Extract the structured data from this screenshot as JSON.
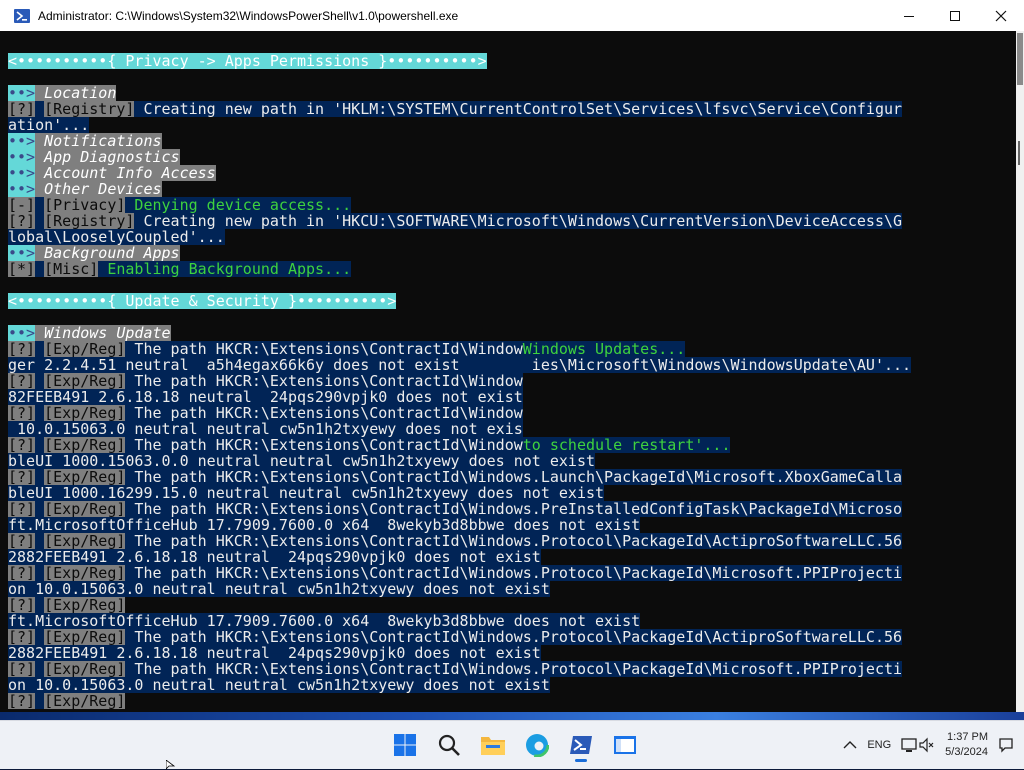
{
  "window": {
    "title": "Administrator: C:\\Windows\\System32\\WindowsPowerShell\\v1.0\\powershell.exe"
  },
  "console": {
    "lines": [
      [],
      [
        {
          "t": "<••••••••••{ ",
          "c": "hdr"
        },
        {
          "t": "Privacy -> Apps Permissions",
          "c": "hdr t"
        },
        {
          "t": " }••••••••••>",
          "c": "hdr"
        }
      ],
      [],
      [
        {
          "t": "••>",
          "c": "bul"
        },
        {
          "t": " Location",
          "c": "itl"
        }
      ],
      [
        {
          "t": "[?]",
          "c": "tag"
        },
        {
          "t": " ",
          "c": "hl"
        },
        {
          "t": "[Registry]",
          "c": "tag"
        },
        {
          "t": " Creating new path in 'HKLM:\\SYSTEM\\CurrentControlSet\\Services\\lfsvc\\Service\\Configur",
          "c": "hl"
        }
      ],
      [
        {
          "t": "ation'...",
          "c": "hl"
        }
      ],
      [
        {
          "t": "••>",
          "c": "bul"
        },
        {
          "t": " Notifications",
          "c": "itl"
        }
      ],
      [
        {
          "t": "••>",
          "c": "bul"
        },
        {
          "t": " App Diagnostics",
          "c": "itl"
        }
      ],
      [
        {
          "t": "••>",
          "c": "bul"
        },
        {
          "t": " Account Info Access",
          "c": "itl"
        }
      ],
      [
        {
          "t": "••>",
          "c": "bul"
        },
        {
          "t": " Other Devices",
          "c": "itl"
        }
      ],
      [
        {
          "t": "[-]",
          "c": "tag"
        },
        {
          "t": " ",
          "c": "hl"
        },
        {
          "t": "[Privacy]",
          "c": "tag"
        },
        {
          "t": " Denying device access...",
          "c": "hl grn"
        }
      ],
      [
        {
          "t": "[?]",
          "c": "tag"
        },
        {
          "t": " ",
          "c": "hl"
        },
        {
          "t": "[Registry]",
          "c": "tag"
        },
        {
          "t": " Creating new path in 'HKCU:\\SOFTWARE\\Microsoft\\Windows\\CurrentVersion\\DeviceAccess\\G",
          "c": "hl"
        }
      ],
      [
        {
          "t": "lobal\\LooselyCoupled'...",
          "c": "hl"
        }
      ],
      [
        {
          "t": "••>",
          "c": "bul"
        },
        {
          "t": " Background Apps",
          "c": "itl"
        }
      ],
      [
        {
          "t": "[*]",
          "c": "tag"
        },
        {
          "t": " ",
          "c": "hl"
        },
        {
          "t": "[Misc]",
          "c": "tag"
        },
        {
          "t": " Enabling Background Apps...",
          "c": "hl grn"
        }
      ],
      [],
      [
        {
          "t": "<••••••••••{ ",
          "c": "hdr"
        },
        {
          "t": "Update & Security",
          "c": "hdr t"
        },
        {
          "t": " }••••••••••>",
          "c": "hdr"
        }
      ],
      [],
      [
        {
          "t": "••>",
          "c": "bul"
        },
        {
          "t": " Windows Update",
          "c": "itl"
        }
      ],
      [
        {
          "t": "[?]",
          "c": "tag"
        },
        {
          "t": " ",
          "c": "hl"
        },
        {
          "t": "[Exp/Reg]",
          "c": "tag"
        },
        {
          "t": " The path HKCR:\\Extensions\\ContractId\\Window",
          "c": "hl"
        },
        {
          "t": "Windows Updates...",
          "c": "hl grn"
        }
      ],
      [
        {
          "t": "ger_2.2.4.51_neutral__a5h4egax66k6y does not exist        ",
          "c": "hl"
        },
        {
          "t": "ies\\Microsoft\\Windows\\WindowsUpdate\\AU'...",
          "c": "hl"
        }
      ],
      [
        {
          "t": "[?]",
          "c": "tag"
        },
        {
          "t": " ",
          "c": "hl"
        },
        {
          "t": "[Exp/Reg]",
          "c": "tag"
        },
        {
          "t": " The path HKCR:\\Extensions\\ContractId\\Window",
          "c": "hl"
        }
      ],
      [
        {
          "t": "82FEEB491_2.6.18.18_neutral__24pqs290vpjk0 does not exist",
          "c": "hl"
        }
      ],
      [
        {
          "t": "[?]",
          "c": "tag"
        },
        {
          "t": " ",
          "c": "hl"
        },
        {
          "t": "[Exp/Reg]",
          "c": "tag"
        },
        {
          "t": " The path HKCR:\\Extensions\\ContractId\\Window",
          "c": "hl"
        }
      ],
      [
        {
          "t": "_10.0.15063.0_neutral_neutral_cw5n1h2txyewy does not exis",
          "c": "hl"
        }
      ],
      [
        {
          "t": "[?]",
          "c": "tag"
        },
        {
          "t": " ",
          "c": "hl"
        },
        {
          "t": "[Exp/Reg]",
          "c": "tag"
        },
        {
          "t": " The path HKCR:\\Extensions\\ContractId\\Window",
          "c": "hl"
        },
        {
          "t": "to schedule restart'...",
          "c": "hl grn"
        }
      ],
      [
        {
          "t": "bleUI_1000.15063.0.0_neutral_neutral_cw5n1h2txyewy does not exist",
          "c": "hl"
        }
      ],
      [
        {
          "t": "[?]",
          "c": "tag"
        },
        {
          "t": " ",
          "c": "hl"
        },
        {
          "t": "[Exp/Reg]",
          "c": "tag"
        },
        {
          "t": " The path HKCR:\\Extensions\\ContractId\\Windows.Launch\\PackageId\\Microsoft.XboxGameCalla",
          "c": "hl"
        }
      ],
      [
        {
          "t": "bleUI_1000.16299.15.0_neutral_neutral_cw5n1h2txyewy does not exist",
          "c": "hl"
        }
      ],
      [
        {
          "t": "[?]",
          "c": "tag"
        },
        {
          "t": " ",
          "c": "hl"
        },
        {
          "t": "[Exp/Reg]",
          "c": "tag"
        },
        {
          "t": " The path HKCR:\\Extensions\\ContractId\\Windows.PreInstalledConfigTask\\PackageId\\Microso",
          "c": "hl"
        }
      ],
      [
        {
          "t": "ft.MicrosoftOfficeHub_17.7909.7600.0_x64__8wekyb3d8bbwe does not exist",
          "c": "hl"
        }
      ],
      [
        {
          "t": "[?]",
          "c": "tag"
        },
        {
          "t": " ",
          "c": "hl"
        },
        {
          "t": "[Exp/Reg]",
          "c": "tag"
        },
        {
          "t": " The path HKCR:\\Extensions\\ContractId\\Windows.Protocol\\PackageId\\ActiproSoftwareLLC.56",
          "c": "hl"
        }
      ],
      [
        {
          "t": "2882FEEB491_2.6.18.18_neutral__24pqs290vpjk0 does not exist",
          "c": "hl"
        }
      ],
      [
        {
          "t": "[?]",
          "c": "tag"
        },
        {
          "t": " ",
          "c": "hl"
        },
        {
          "t": "[Exp/Reg]",
          "c": "tag"
        },
        {
          "t": " The path HKCR:\\Extensions\\ContractId\\Windows.Protocol\\PackageId\\Microsoft.PPIProjecti",
          "c": "hl"
        }
      ],
      [
        {
          "t": "on_10.0.15063.0_neutral_neutral_cw5n1h2txyewy does not exist",
          "c": "hl"
        }
      ],
      [
        {
          "t": "[?]",
          "c": "tag"
        },
        {
          "t": " ",
          "c": "hl"
        },
        {
          "t": "[Exp/Reg]",
          "c": "tag"
        }
      ],
      [
        {
          "t": "ft.MicrosoftOfficeHub_17.7909.7600.0_x64__8wekyb3d8bbwe does not exist",
          "c": "hl"
        }
      ],
      [
        {
          "t": "[?]",
          "c": "tag"
        },
        {
          "t": " ",
          "c": "hl"
        },
        {
          "t": "[Exp/Reg]",
          "c": "tag"
        },
        {
          "t": " The path HKCR:\\Extensions\\ContractId\\Windows.Protocol\\PackageId\\ActiproSoftwareLLC.56",
          "c": "hl"
        }
      ],
      [
        {
          "t": "2882FEEB491_2.6.18.18_neutral__24pqs290vpjk0 does not exist",
          "c": "hl"
        }
      ],
      [
        {
          "t": "[?]",
          "c": "tag"
        },
        {
          "t": " ",
          "c": "hl"
        },
        {
          "t": "[Exp/Reg]",
          "c": "tag"
        },
        {
          "t": " The path HKCR:\\Extensions\\ContractId\\Windows.Protocol\\PackageId\\Microsoft.PPIProjecti",
          "c": "hl"
        }
      ],
      [
        {
          "t": "on_10.0.15063.0_neutral_neutral_cw5n1h2txyewy does not exist",
          "c": "hl"
        }
      ],
      [
        {
          "t": "[?]",
          "c": "tag"
        },
        {
          "t": " ",
          "c": "hl"
        },
        {
          "t": "[Exp/Reg]",
          "c": "tag"
        }
      ]
    ]
  },
  "taskbar": {
    "icons": [
      {
        "name": "start-button-icon",
        "active": false
      },
      {
        "name": "search-icon",
        "active": false
      },
      {
        "name": "file-explorer-icon",
        "active": false
      },
      {
        "name": "edge-browser-icon",
        "active": false
      },
      {
        "name": "powershell-icon",
        "active": true
      },
      {
        "name": "window-app-icon",
        "active": false
      }
    ],
    "tray": {
      "language": "ENG",
      "time": "1:37 PM",
      "date": "5/3/2024"
    }
  },
  "colors": {
    "console_bg": "#0c0c0c",
    "highlight_bg": "#012456",
    "header_bg": "#64d8d8",
    "tag_bg": "#7f7f7f",
    "success": "#3ed23e"
  }
}
